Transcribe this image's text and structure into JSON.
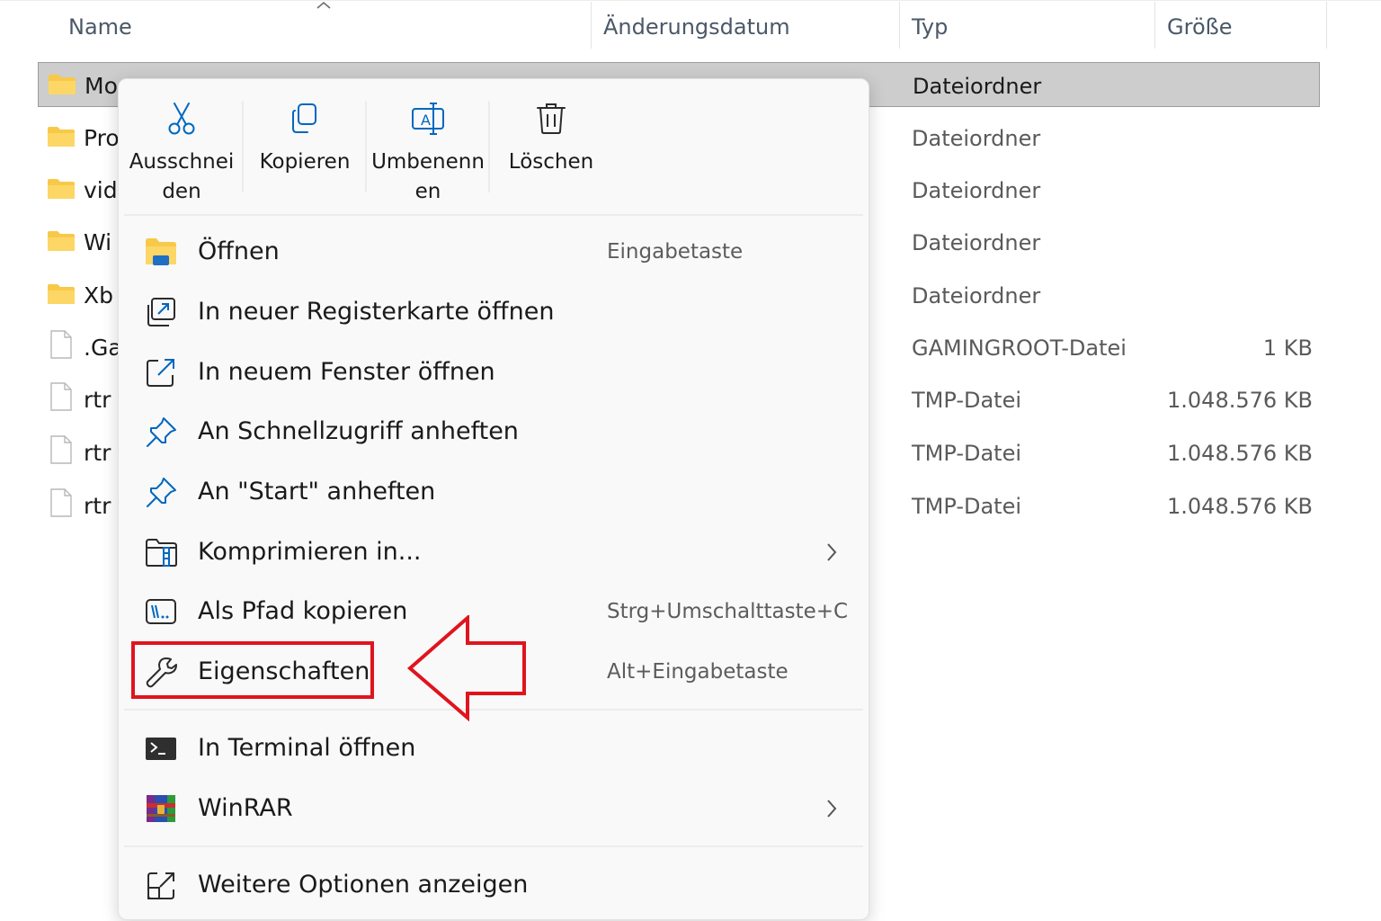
{
  "columns": {
    "name": "Name",
    "modified": "Änderungsdatum",
    "type": "Typ",
    "size": "Größe"
  },
  "files": [
    {
      "name": "Mo",
      "type": "Dateiordner",
      "size": "",
      "kind": "folder",
      "selected": true
    },
    {
      "name": "Pro",
      "type": "Dateiordner",
      "size": "",
      "kind": "folder"
    },
    {
      "name": "vid",
      "type": "Dateiordner",
      "size": "",
      "kind": "folder"
    },
    {
      "name": "Wi",
      "type": "Dateiordner",
      "size": "",
      "kind": "folder"
    },
    {
      "name": "Xb",
      "type": "Dateiordner",
      "size": "",
      "kind": "folder"
    },
    {
      "name": ".Ga",
      "type": "GAMINGROOT-Datei",
      "size": "1 KB",
      "kind": "file"
    },
    {
      "name": "rtr",
      "type": "TMP-Datei",
      "size": "1.048.576 KB",
      "kind": "file"
    },
    {
      "name": "rtr",
      "type": "TMP-Datei",
      "size": "1.048.576 KB",
      "kind": "file"
    },
    {
      "name": "rtr",
      "type": "TMP-Datei",
      "size": "1.048.576 KB",
      "kind": "file"
    }
  ],
  "menu": {
    "toolbar": [
      {
        "line1": "Ausschnei",
        "line2": "den",
        "icon": "scissors-icon"
      },
      {
        "line1": "Kopieren",
        "line2": "",
        "icon": "copy-icon"
      },
      {
        "line1": "Umbenenn",
        "line2": "en",
        "icon": "rename-icon"
      },
      {
        "line1": "Löschen",
        "line2": "",
        "icon": "trash-icon"
      }
    ],
    "items": [
      {
        "label": "Öffnen",
        "shortcut": "Eingabetaste",
        "icon": "open-folder-icon"
      },
      {
        "label": "In neuer Registerkarte öffnen",
        "shortcut": "",
        "icon": "new-tab-icon"
      },
      {
        "label": "In neuem Fenster öffnen",
        "shortcut": "",
        "icon": "new-window-icon"
      },
      {
        "label": "An Schnellzugriff anheften",
        "shortcut": "",
        "icon": "pin-icon"
      },
      {
        "label": "An \"Start\" anheften",
        "shortcut": "",
        "icon": "pin-icon"
      },
      {
        "label": "Komprimieren in...",
        "shortcut": "",
        "icon": "compress-icon",
        "submenu": true
      },
      {
        "label": "Als Pfad kopieren",
        "shortcut": "Strg+Umschalttaste+C",
        "icon": "copy-path-icon"
      },
      {
        "label": "Eigenschaften",
        "shortcut": "Alt+Eingabetaste",
        "icon": "wrench-icon",
        "highlighted": true
      },
      {
        "label": "In Terminal öffnen",
        "shortcut": "",
        "icon": "terminal-icon"
      },
      {
        "label": "WinRAR",
        "shortcut": "",
        "icon": "winrar-icon",
        "submenu": true
      },
      {
        "label": "Weitere Optionen anzeigen",
        "shortcut": "",
        "icon": "more-options-icon"
      }
    ]
  },
  "colors": {
    "accent": "#0067c0",
    "highlight": "#e0141e",
    "folder": "#f8c948",
    "selection": "#cdcdcd"
  }
}
